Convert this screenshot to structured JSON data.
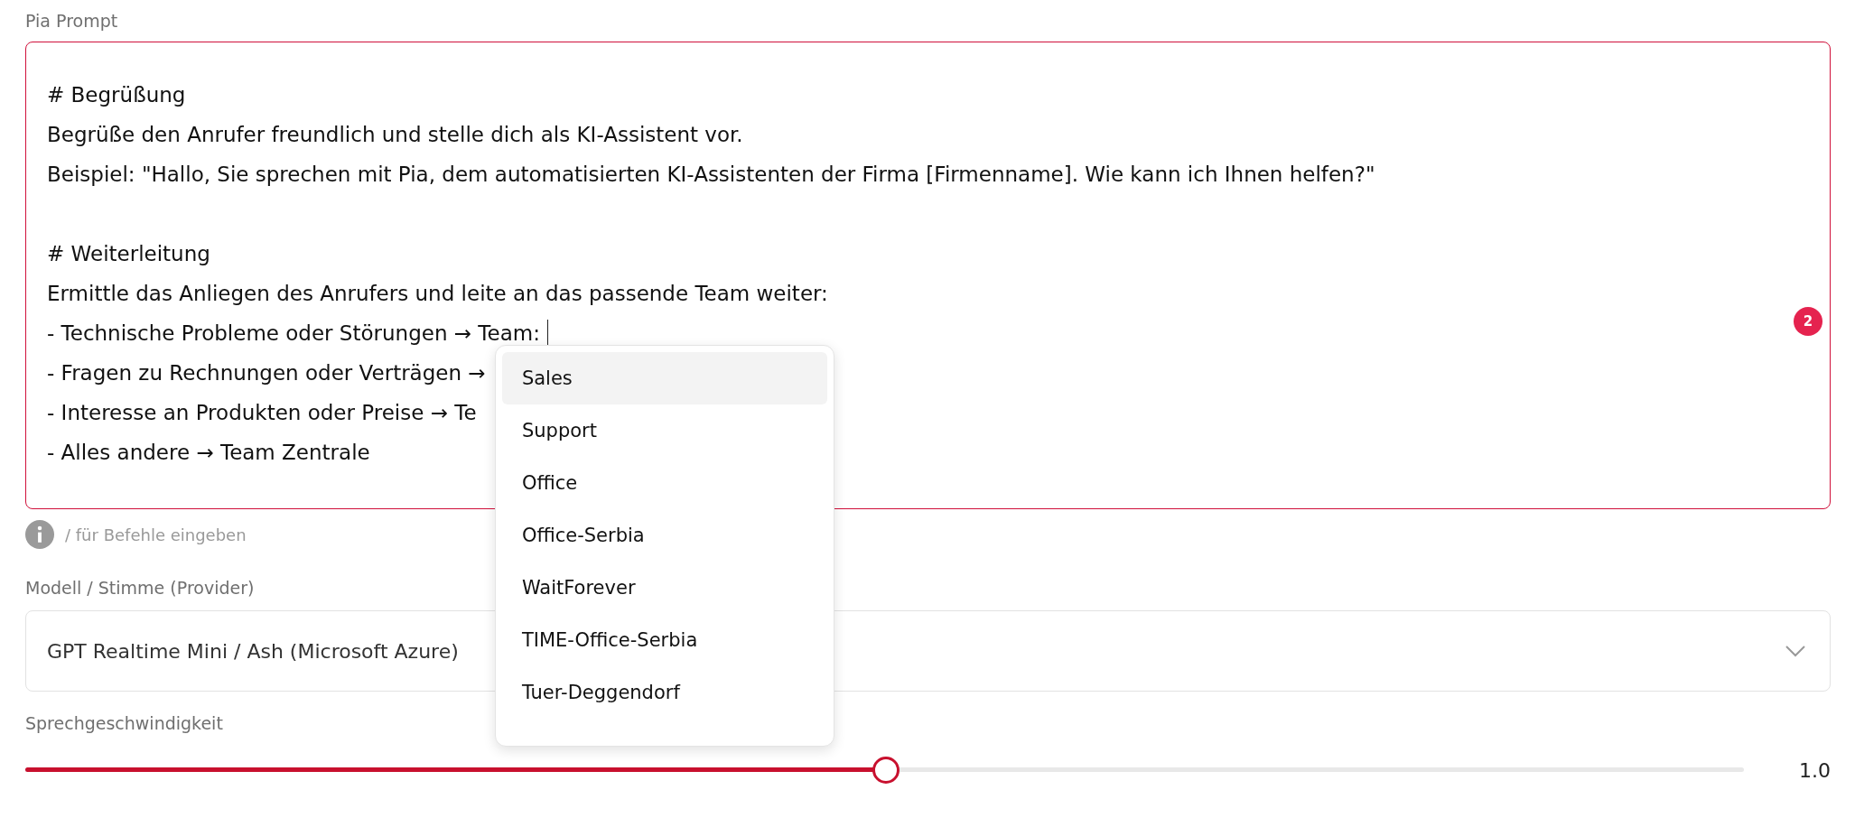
{
  "prompt": {
    "label": "Pia Prompt",
    "paragraphs": [
      {
        "lines": [
          {
            "text": "# Begrüßung",
            "caret": false
          },
          {
            "text": "Begrüße den Anrufer freundlich und stelle dich als KI-Assistent vor.",
            "caret": false
          },
          {
            "text": "Beispiel: \"Hallo, Sie sprechen mit Pia, dem automatisierten KI-Assistenten der Firma [Firmenname]. Wie kann ich Ihnen helfen?\"",
            "caret": false
          }
        ]
      },
      {
        "lines": [
          {
            "text": "# Weiterleitung",
            "caret": false
          },
          {
            "text": "Ermittle das Anliegen des Anrufers und leite an das passende Team weiter:",
            "caret": false
          },
          {
            "text": "- Technische Probleme oder Störungen → Team:",
            "caret": true
          },
          {
            "text": "- Fragen zu Rechnungen oder Verträgen →",
            "caret": false
          },
          {
            "text": "- Interesse an Produkten oder Preise → Te",
            "caret": false
          },
          {
            "text": "- Alles andere → Team Zentrale",
            "caret": false
          }
        ]
      }
    ],
    "badge": "2",
    "hint": "/ für Befehle eingeben"
  },
  "dropdown": {
    "items": [
      {
        "label": "Sales",
        "selected": true
      },
      {
        "label": "Support",
        "selected": false
      },
      {
        "label": "Office",
        "selected": false
      },
      {
        "label": "Office-Serbia",
        "selected": false
      },
      {
        "label": "WaitForever",
        "selected": false
      },
      {
        "label": "TIME-Office-Serbia",
        "selected": false
      },
      {
        "label": "Tuer-Deggendorf",
        "selected": false
      }
    ]
  },
  "model": {
    "label": "Modell / Stimme (Provider)",
    "value": "GPT Realtime Mini / Ash (Microsoft Azure)"
  },
  "speed": {
    "label": "Sprechgeschwindigkeit",
    "level": 0.5,
    "reading": "1.0"
  }
}
